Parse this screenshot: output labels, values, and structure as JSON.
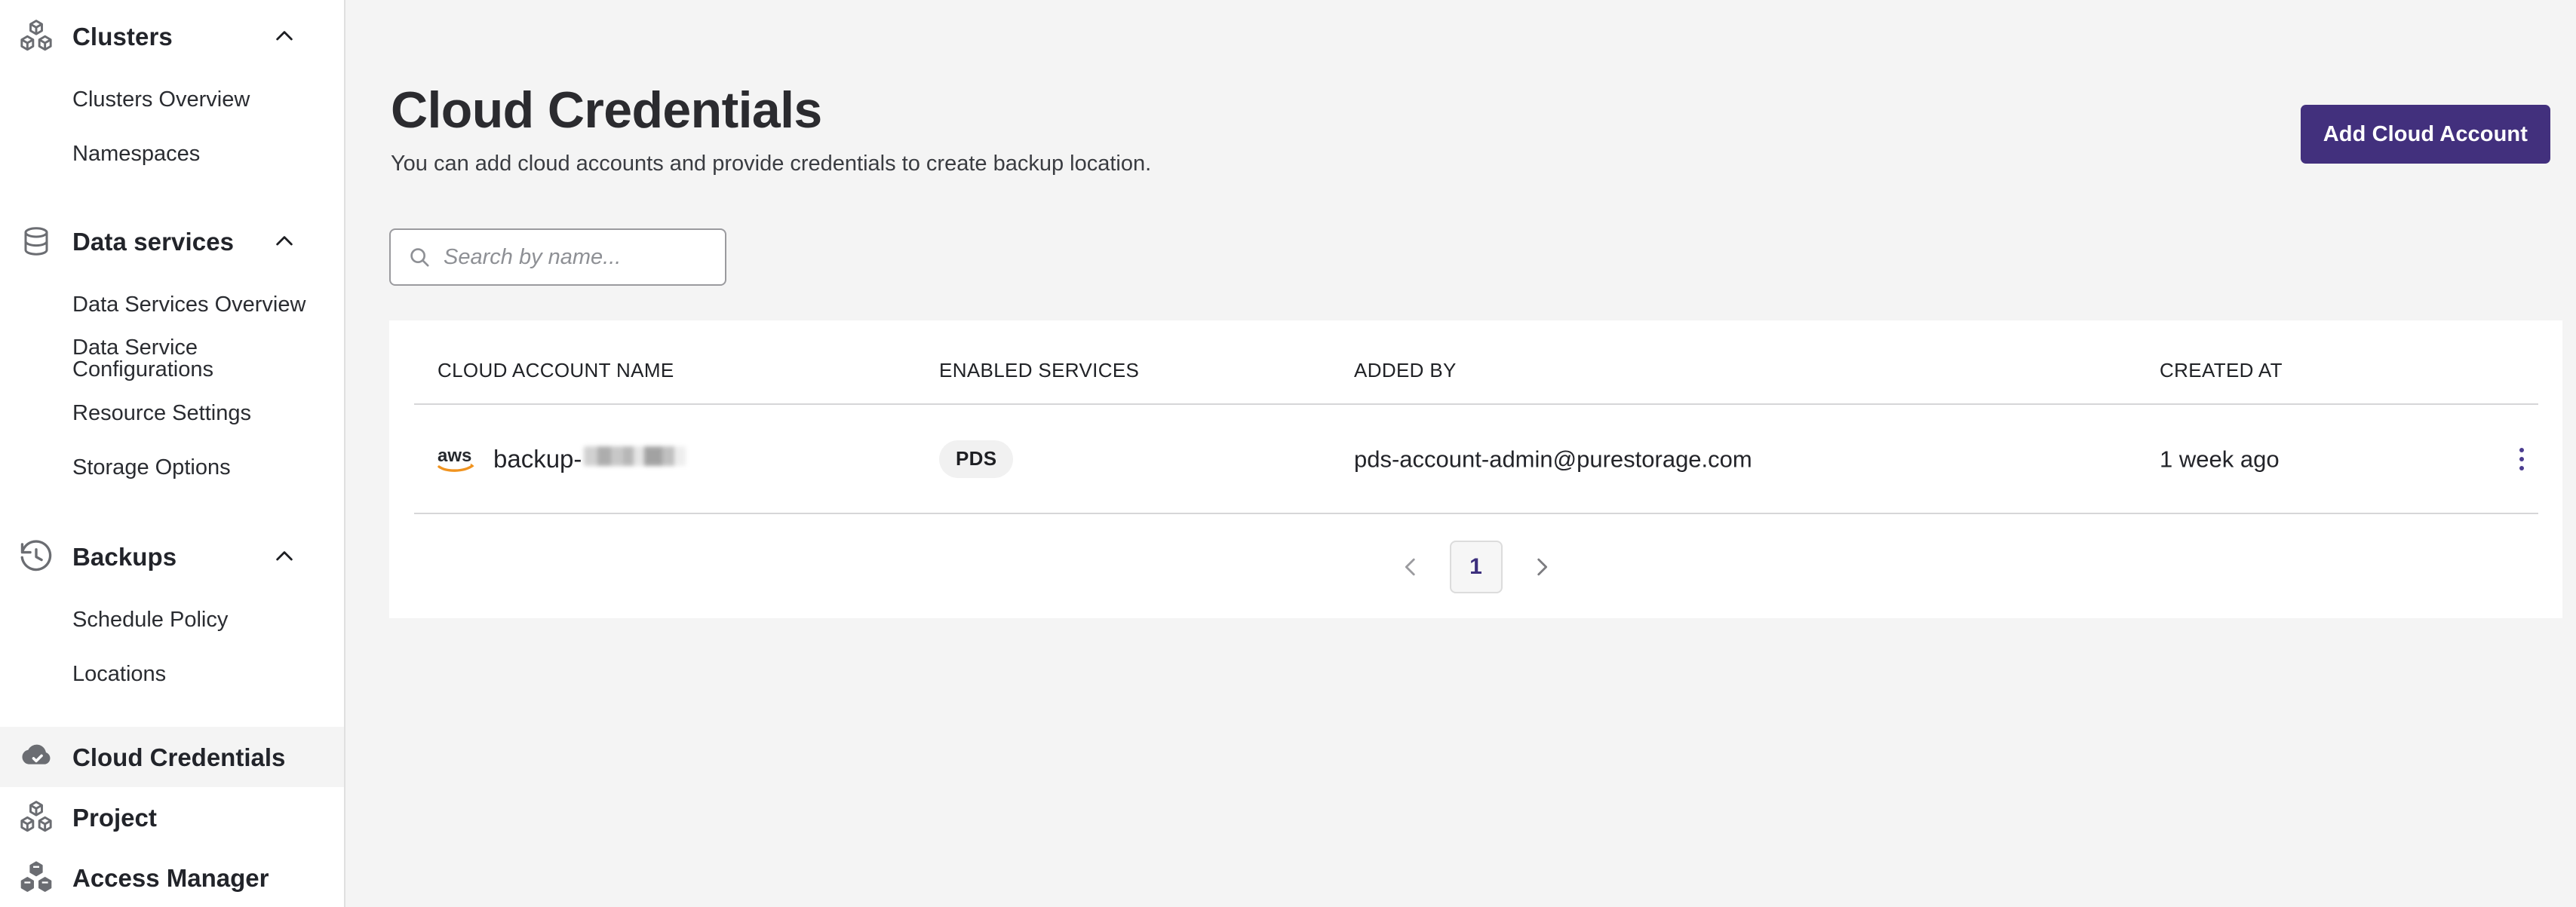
{
  "sidebar": {
    "groups": [
      {
        "label": "Clusters",
        "icon": "cubes-outline-icon",
        "expanded": true,
        "chevron": "chevron-up-icon",
        "items": [
          {
            "label": "Clusters Overview"
          },
          {
            "label": "Namespaces"
          }
        ]
      },
      {
        "label": "Data services",
        "icon": "database-icon",
        "expanded": true,
        "chevron": "chevron-up-icon",
        "items": [
          {
            "label": "Data Services Overview"
          },
          {
            "label": "Data Service Configurations"
          },
          {
            "label": "Resource Settings"
          },
          {
            "label": "Storage Options"
          }
        ]
      },
      {
        "label": "Backups",
        "icon": "history-clock-icon",
        "expanded": true,
        "chevron": "chevron-up-icon",
        "items": [
          {
            "label": "Schedule Policy"
          },
          {
            "label": "Locations"
          }
        ]
      }
    ],
    "items": [
      {
        "label": "Cloud Credentials",
        "icon": "cloud-check-icon",
        "active": true
      },
      {
        "label": "Project",
        "icon": "cubes-outline-icon",
        "active": false
      },
      {
        "label": "Access Manager",
        "icon": "cubes-filled-icon",
        "active": false
      }
    ]
  },
  "header": {
    "title": "Cloud Credentials",
    "subtitle": "You can add cloud accounts and provide credentials to create backup location.",
    "add_button_label": "Add Cloud Account"
  },
  "search": {
    "placeholder": "Search by name...",
    "value": "",
    "icon": "search-icon"
  },
  "table": {
    "columns": [
      "CLOUD ACCOUNT NAME",
      "ENABLED SERVICES",
      "ADDED BY",
      "CREATED AT"
    ],
    "rows": [
      {
        "provider_icon": "aws-logo-icon",
        "account_name_prefix": "backup-",
        "account_name_redacted": true,
        "enabled_services": "PDS",
        "added_by": "pds-account-admin@purestorage.com",
        "created_at": "1 week ago",
        "row_menu_icon": "kebab-menu-icon"
      }
    ]
  },
  "pagination": {
    "prev_icon": "chevron-left-icon",
    "next_icon": "chevron-right-icon",
    "current_page": "1"
  },
  "colors": {
    "accent_purple": "#42307d",
    "page_background": "#f4f4f4",
    "card_background": "#ffffff",
    "aws_orange": "#f0931f",
    "badge_background": "#f1f1f1",
    "divider": "#d6d6d8"
  }
}
